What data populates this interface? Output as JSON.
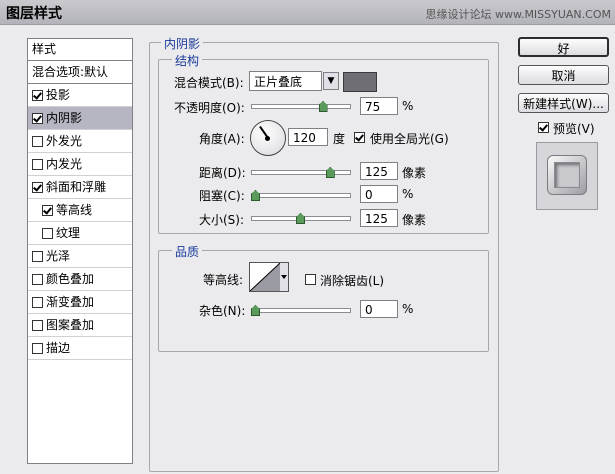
{
  "window": {
    "title": "图层样式",
    "watermark": "思缘设计论坛 www.MISSYUAN.COM"
  },
  "sidebar": {
    "header": "样式",
    "blend_options": "混合选项:默认",
    "items": [
      {
        "label": "投影",
        "checked": true,
        "selected": false,
        "indent": false
      },
      {
        "label": "内阴影",
        "checked": true,
        "selected": true,
        "indent": false
      },
      {
        "label": "外发光",
        "checked": false,
        "selected": false,
        "indent": false
      },
      {
        "label": "内发光",
        "checked": false,
        "selected": false,
        "indent": false
      },
      {
        "label": "斜面和浮雕",
        "checked": true,
        "selected": false,
        "indent": false
      },
      {
        "label": "等高线",
        "checked": true,
        "selected": false,
        "indent": true
      },
      {
        "label": "纹理",
        "checked": false,
        "selected": false,
        "indent": true
      },
      {
        "label": "光泽",
        "checked": false,
        "selected": false,
        "indent": false
      },
      {
        "label": "颜色叠加",
        "checked": false,
        "selected": false,
        "indent": false
      },
      {
        "label": "渐变叠加",
        "checked": false,
        "selected": false,
        "indent": false
      },
      {
        "label": "图案叠加",
        "checked": false,
        "selected": false,
        "indent": false
      },
      {
        "label": "描边",
        "checked": false,
        "selected": false,
        "indent": false
      }
    ]
  },
  "panel": {
    "title": "内阴影",
    "structure": {
      "title": "结构",
      "blend_mode_label": "混合模式(B):",
      "blend_mode_value": "正片叠底",
      "shadow_color": "#6e6e74",
      "opacity_label": "不透明度(O):",
      "opacity_value": "75",
      "opacity_fraction": 0.75,
      "percent": "%",
      "angle_label": "角度(A):",
      "angle_value": "120",
      "degree": "度",
      "global_light_label": "使用全局光(G)",
      "global_light_checked": true,
      "distance_label": "距离(D):",
      "distance_value": "125",
      "distance_fraction": 0.83,
      "px_unit": "像素",
      "choke_label": "阻塞(C):",
      "choke_value": "0",
      "choke_fraction": 0,
      "size_label": "大小(S):",
      "size_value": "125",
      "size_fraction": 0.5
    },
    "quality": {
      "title": "品质",
      "contour_label": "等高线:",
      "antialias_label": "消除锯齿(L)",
      "antialias_checked": false,
      "noise_label": "杂色(N):",
      "noise_value": "0",
      "noise_fraction": 0
    }
  },
  "buttons": {
    "ok": "好",
    "cancel": "取消",
    "new_style": "新建样式(W)...",
    "preview_label": "预览(V)",
    "preview_checked": true
  }
}
